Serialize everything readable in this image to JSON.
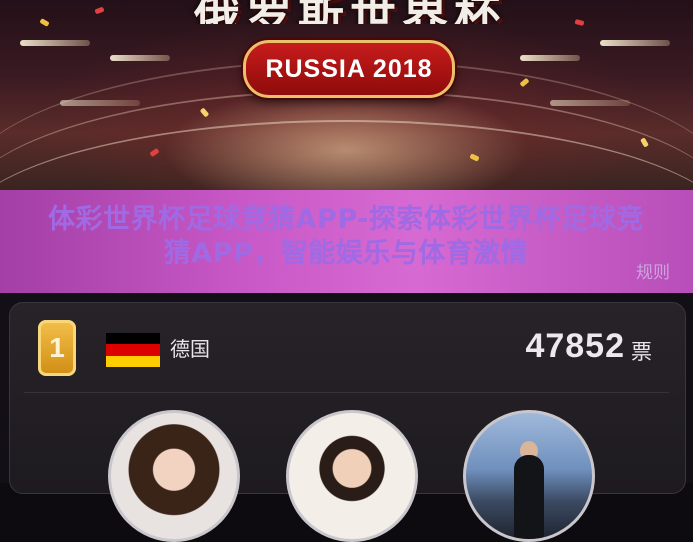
{
  "hero": {
    "title_partial": "俄罗斯世界杯",
    "badge_text": "RUSSIA 2018"
  },
  "overlay": {
    "title": "体彩世界杯足球竞猜APP-探索体彩世界杯足球竞猜APP，智能娱乐与体育激情",
    "rules_link": "规则"
  },
  "ranking": {
    "rank": "1",
    "country": "德国",
    "flag_colors": [
      "#000000",
      "#dd0000",
      "#ffce00"
    ],
    "votes": "47852",
    "votes_unit": "票"
  },
  "colors": {
    "accent_magenta": "#c858c6",
    "badge_red": "#c71c1c",
    "gold": "#f3c04a"
  }
}
